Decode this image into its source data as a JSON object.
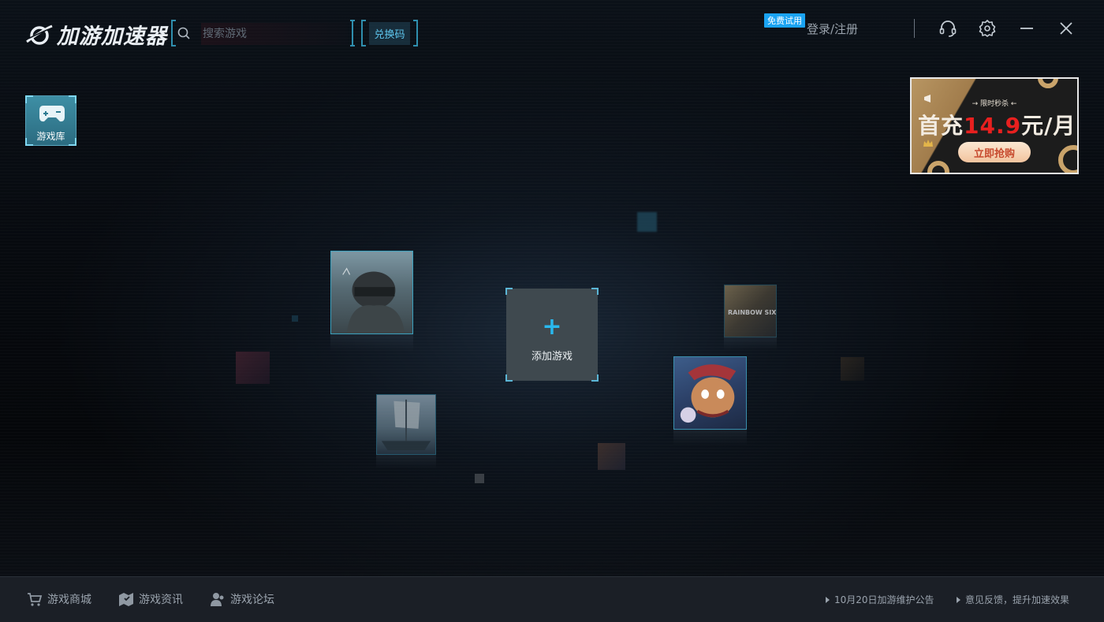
{
  "app": {
    "logo_text": "加游加速器"
  },
  "header": {
    "search_placeholder": "搜索游戏",
    "redeem_label": "兑换码",
    "trial_badge": "免费试用",
    "login_label": "登录/注册"
  },
  "sidebar": {
    "library_label": "游戏库"
  },
  "ad": {
    "tagline": "→ 限时秒杀 ←",
    "headline_prefix": "首充",
    "headline_price": "14.9",
    "headline_suffix": "元/月",
    "button_label": "立即抢购"
  },
  "main": {
    "add_game_label": "添加游戏",
    "game_tiles": [
      {
        "name": "pubg-game-tile"
      },
      {
        "name": "rainbow-six-siege-game-tile",
        "text": "RAINBOW SIX SIEGE"
      },
      {
        "name": "hero-cartoon-game-tile"
      },
      {
        "name": "pirate-ship-game-tile"
      }
    ]
  },
  "footer": {
    "nav": [
      {
        "label": "游戏商城",
        "icon": "cart-icon"
      },
      {
        "label": "游戏资讯",
        "icon": "news-map-icon"
      },
      {
        "label": "游戏论坛",
        "icon": "forum-users-icon"
      }
    ],
    "notice_maintenance": "10月20日加游维护公告",
    "notice_feedback": "意见反馈，提升加速效果"
  },
  "colors": {
    "accent": "#29b8ee",
    "frame": "#2f8fae",
    "trial_badge": "#1aa3f2",
    "price_red": "#e8201f"
  }
}
